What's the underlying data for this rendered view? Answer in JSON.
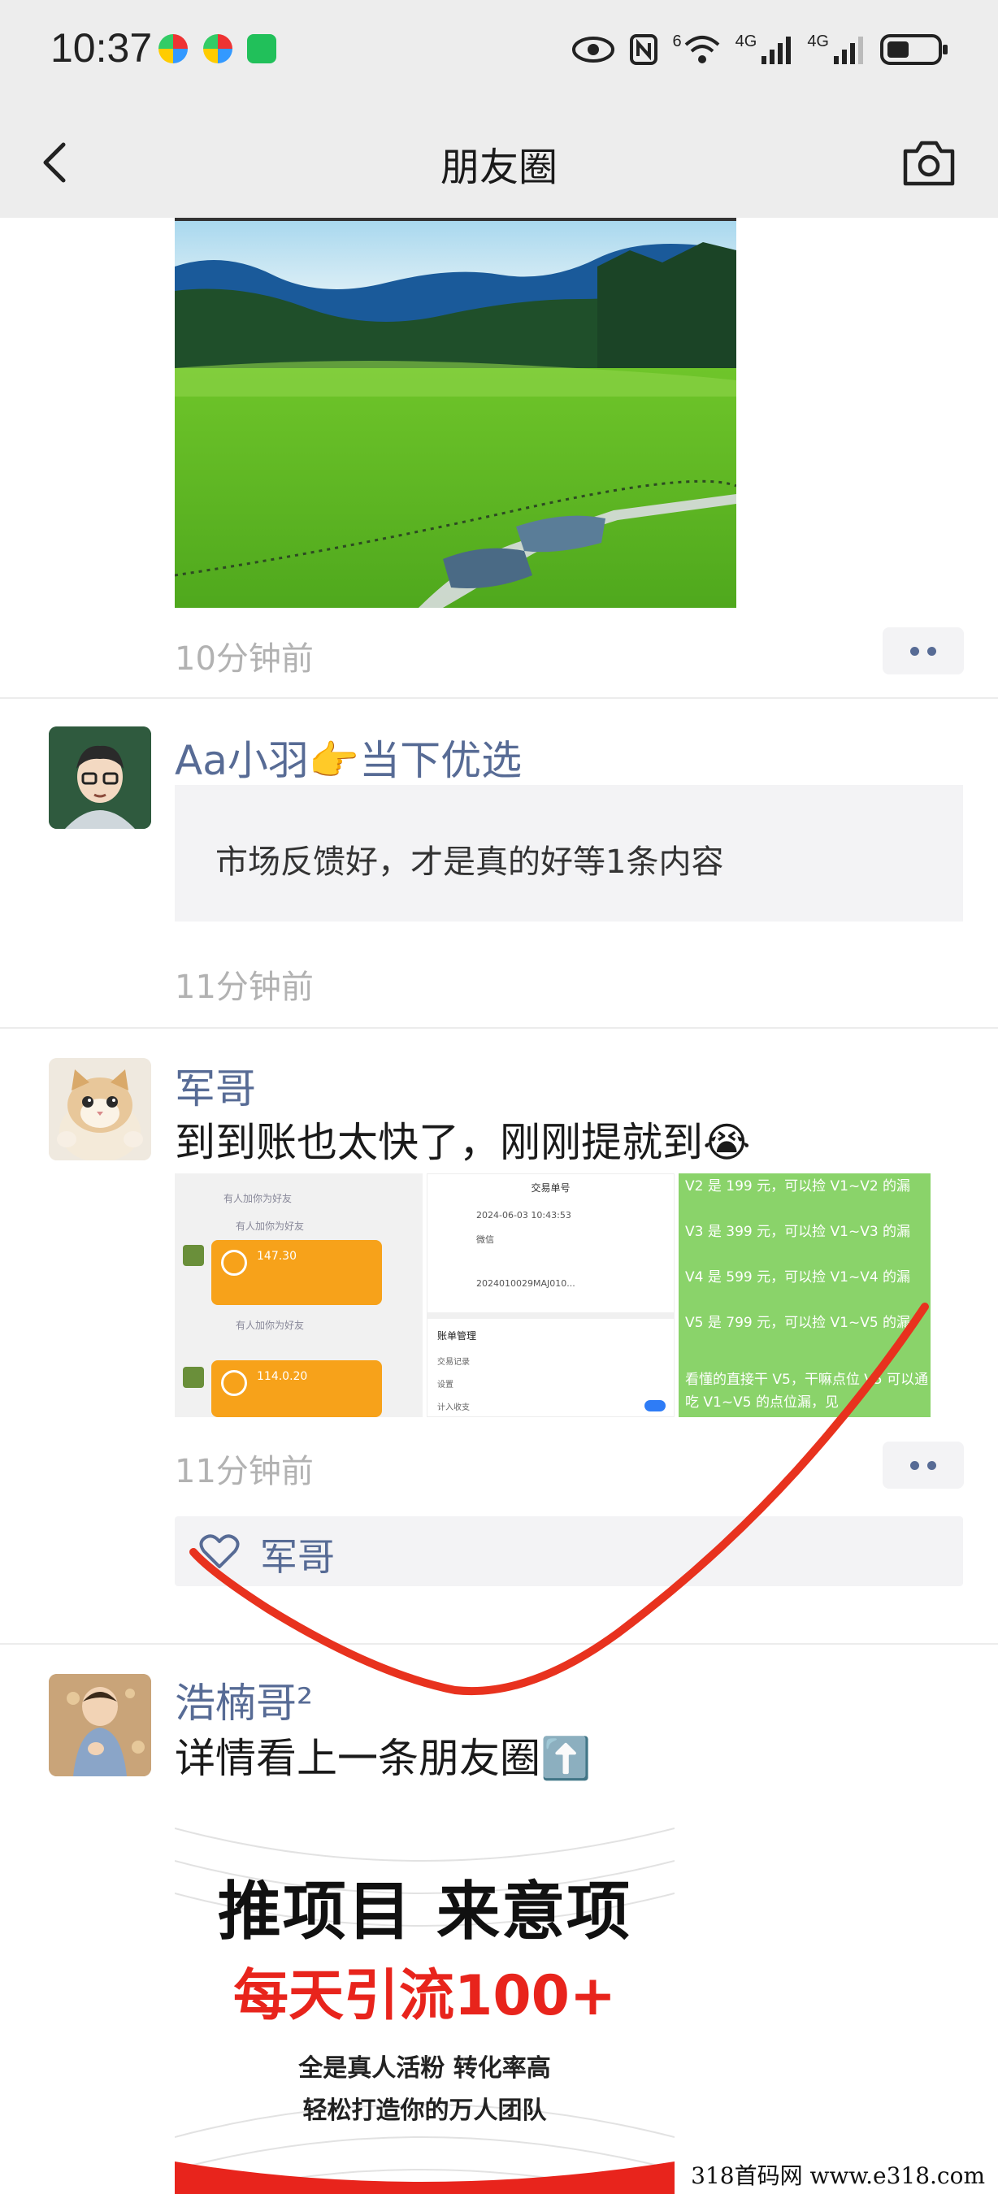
{
  "status_bar": {
    "time": "10:37",
    "network_labels": [
      "6",
      "4G",
      "4G"
    ],
    "icons": [
      "eye-icon",
      "nfc-icon",
      "wifi-icon",
      "signal-icon",
      "signal-icon",
      "battery-icon"
    ]
  },
  "nav": {
    "title": "朋友圈",
    "back_icon": "chevron-left-icon",
    "camera_icon": "camera-icon"
  },
  "posts": [
    {
      "image": "landscape-meadow-photo",
      "time_ago": "10分钟前"
    },
    {
      "name": "Aa小羽👉当下优选",
      "share_text": "市场反馈好，才是真的好等1条内容",
      "time_ago": "11分钟前"
    },
    {
      "name": "军哥",
      "text": "到到账也太快了，刚刚提就到😭",
      "image1": {
        "lines": [
          "有人加你为好友",
          "有人加你为好友",
          "有人加你为好友",
          "147.30",
          "114.0.20"
        ]
      },
      "image2": {
        "title": "交易单号",
        "rows": [
          "2024-06-03 10:43:53",
          "微信",
          "2024010029MAJ010..."
        ],
        "section": "账单管理",
        "section_rows": [
          "交易记录",
          "设置",
          "计入收支"
        ]
      },
      "image3": {
        "lines": [
          "V2 是 199 元，可以捡 V1~V2 的漏",
          "V3 是 399 元，可以捡 V1~V3 的漏",
          "V4 是 599 元，可以捡 V1~V4 的漏",
          "V5 是 799 元，可以捡 V1~V5 的漏",
          "看懂的直接干 V5，干嘛点位 V5 可以通吃 V1~V5 的点位漏，见"
        ]
      },
      "time_ago": "11分钟前",
      "likes": "军哥"
    },
    {
      "name": "浩楠哥²",
      "text": "详情看上一条朋友圈⬆️",
      "poster": {
        "line1": "推项目 来意项",
        "line2": "每天引流100+",
        "line3": "全是真人活粉 转化率高",
        "line4": "轻松打造你的万人团队"
      }
    }
  ],
  "watermark": "318首码网 www.e318.com",
  "colors": {
    "name_blue": "#576b95",
    "bar_gray": "#ededed",
    "scribble_red": "#e8321e",
    "poster_red": "#e8241c"
  }
}
